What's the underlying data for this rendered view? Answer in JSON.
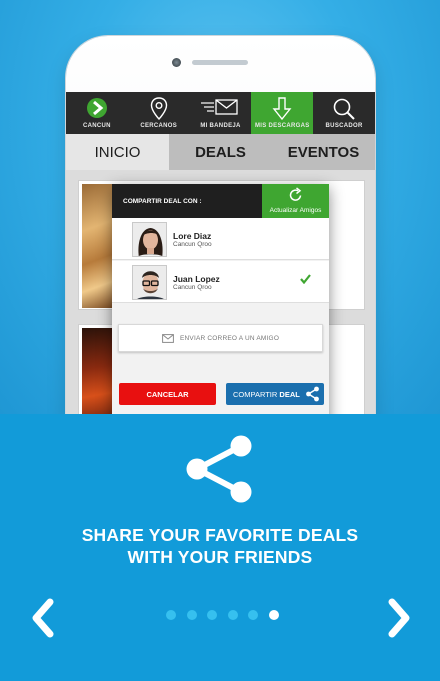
{
  "nav": {
    "items": [
      {
        "label": "CANCUN",
        "icon": "logo-arrow-icon"
      },
      {
        "label": "CERCANOS",
        "icon": "location-pin-icon"
      },
      {
        "label": "MI BANDEJA",
        "icon": "mail-icon"
      },
      {
        "label": "MIS DESCARGAS",
        "icon": "download-arrow-icon",
        "active": true
      },
      {
        "label": "BUSCADOR",
        "icon": "search-icon"
      }
    ]
  },
  "tabs": [
    {
      "label": "INICIO",
      "selected": true
    },
    {
      "label": "DEALS"
    },
    {
      "label": "EVENTOS"
    }
  ],
  "dialog": {
    "title": "COMPARTIR DEAL CON :",
    "refresh_label": "Actualizar Amigos",
    "friends": [
      {
        "name": "Lore Diaz",
        "city": "Cancun Qroo",
        "selected": false
      },
      {
        "name": "Juan Lopez",
        "city": "Cancun Qroo",
        "selected": true
      }
    ],
    "email_label": "ENVIAR CORREO A UN AMIGO",
    "cancel_label": "CANCELAR",
    "share_label_prefix": "COMPARTIR ",
    "share_label_bold": "DEAL"
  },
  "promo": {
    "headline_line1": "SHARE YOUR FAVORITE DEALS",
    "headline_line2": "WITH YOUR FRIENDS",
    "page_count": 6,
    "current_page": 6
  },
  "colors": {
    "brand_blue": "#129bd9",
    "active_green": "#3fa631",
    "cancel_red": "#e81010",
    "share_blue": "#1b6fae"
  }
}
